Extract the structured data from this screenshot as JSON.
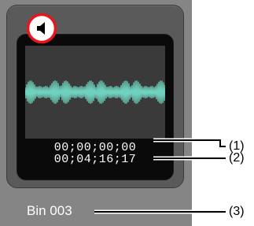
{
  "clip": {
    "name": "Bin 003",
    "timecode_in": "00;00;00;00",
    "timecode_out": "00;04;16;17"
  },
  "callouts": [
    {
      "label": "(1)"
    },
    {
      "label": "(2)"
    },
    {
      "label": "(3)"
    }
  ],
  "icons": {
    "clip_type": "speaker-icon"
  },
  "colors": {
    "background": "#858585",
    "waveform": "#6fd1bd",
    "highlight_ring": "#e8141e"
  }
}
